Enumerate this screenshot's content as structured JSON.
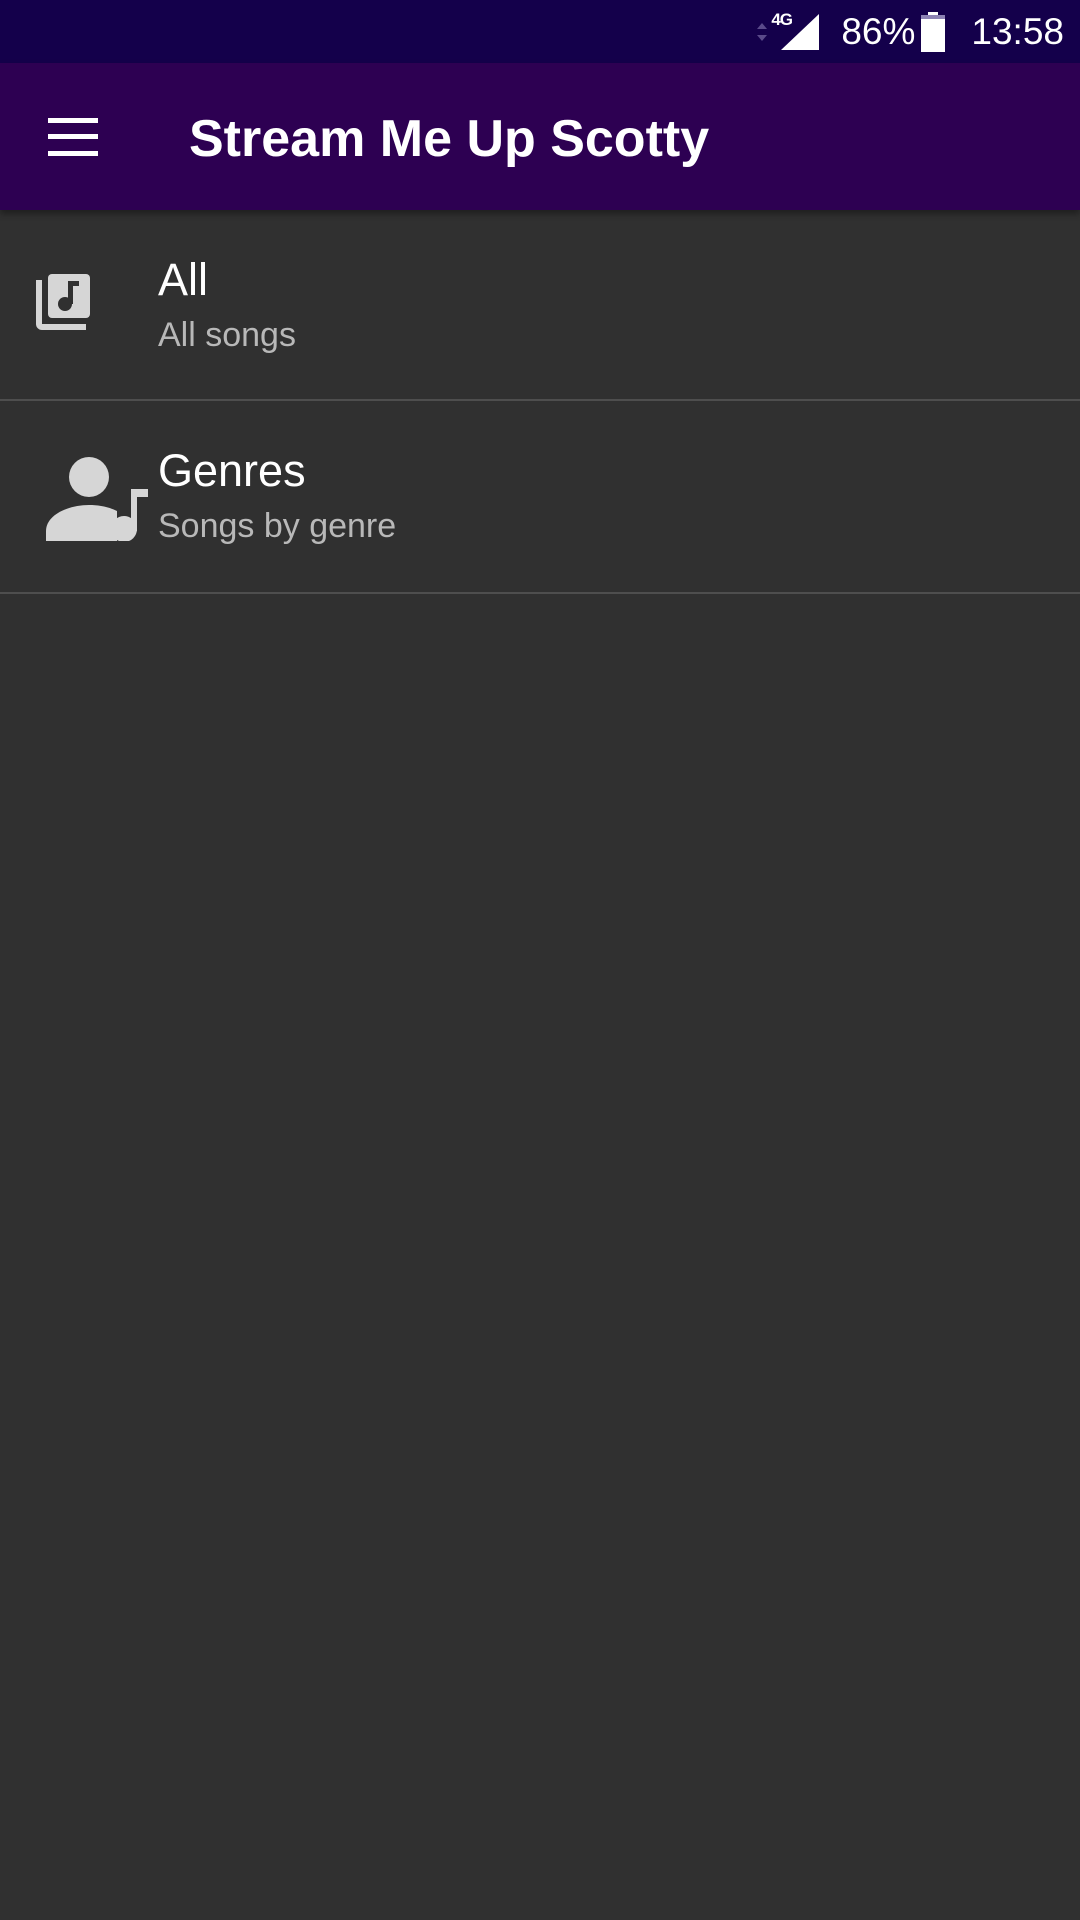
{
  "status_bar": {
    "network_type": "4G",
    "battery_percent": "86%",
    "time": "13:58",
    "icons": [
      "data-activity-icon",
      "signal-icon",
      "battery-icon"
    ]
  },
  "app_bar": {
    "title": "Stream Me Up Scotty",
    "menu_icon": "menu-icon"
  },
  "list": {
    "items": [
      {
        "title": "All",
        "subtitle": "All songs",
        "icon": "library-music-icon"
      },
      {
        "title": "Genres",
        "subtitle": "Songs by genre",
        "icon": "person-music-icon"
      }
    ]
  },
  "colors": {
    "status_bar_bg": "#14004b",
    "app_bar_bg": "#2d0052",
    "background": "#303030",
    "divider": "#4e4e4e",
    "icon_gray": "#d6d6d6",
    "subtitle_gray": "#b8b8b8"
  }
}
